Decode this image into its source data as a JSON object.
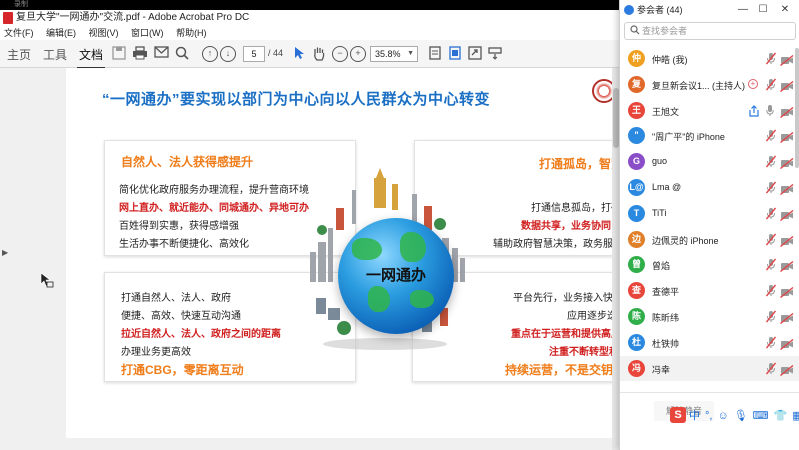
{
  "acrobat": {
    "top_strip": "录制",
    "window_title": "复旦大学\"一网通办\"交流.pdf - Adobe Acrobat Pro DC",
    "menu": [
      "文件(F)",
      "编辑(E)",
      "视图(V)",
      "窗口(W)",
      "帮助(H)"
    ],
    "tabs": [
      "主页",
      "工具",
      "文档"
    ],
    "active_tab": "文档",
    "page_current": "5",
    "page_total": "/ 44",
    "zoom": "35.8%"
  },
  "slide": {
    "title": "“一网通办”要实现以部门为中心向以人民群众为中心转变",
    "globe_label": "一网通办",
    "card_tl": {
      "heading": "自然人、法人获得感提升",
      "lines": [
        "简化优化政府服务办理流程，提升营商环境",
        "网上直办、就近能办、同城通办、异地可办",
        "百姓得到实惠，获得感增强",
        "生活办事不断便捷化、高效化"
      ]
    },
    "card_tr": {
      "heading": "打通孤岛，智慧",
      "lines": [
        "打通信息孤岛，打破",
        "数据共享，业务协同，",
        "辅助政府智慧决策，政务服务"
      ]
    },
    "card_bl": {
      "lines": [
        "打通自然人、法人、政府",
        "便捷、高效、快速互动沟通",
        "拉近自然人、法人、政府之间的距离",
        "办理业务更高效"
      ],
      "footer": "打通CBG，零距离互动"
    },
    "card_br": {
      "lines": [
        "平台先行，业务接入快速",
        "应用逐步迭",
        "重点在于运营和提供高质",
        "注重不断转型和"
      ],
      "footer": "持续运营，不是交钥"
    }
  },
  "participants": {
    "title": "参会者 (44)",
    "search_placeholder": "查找参会者",
    "list": [
      {
        "avatar": "仲",
        "name": "仲皓 (我)",
        "color": "#f0a020"
      },
      {
        "avatar": "复",
        "name": "复旦新会议1... (主持人)",
        "color": "#e0682a",
        "host": true
      },
      {
        "avatar": "王",
        "name": "王旭文",
        "color": "#e8463a",
        "sharing": true
      },
      {
        "avatar": "\"",
        "name": "\"周广平\"的 iPhone",
        "color": "#2b8ae0"
      },
      {
        "avatar": "G",
        "name": "guo",
        "color": "#8a4fc8"
      },
      {
        "avatar": "L@",
        "name": "Lma @",
        "color": "#2b8ae0"
      },
      {
        "avatar": "T",
        "name": "TiTi",
        "color": "#2b8ae0"
      },
      {
        "avatar": "边",
        "name": "边佩灵的 iPhone",
        "color": "#e0802a"
      },
      {
        "avatar": "曾",
        "name": "曾焰",
        "color": "#2fae4a"
      },
      {
        "avatar": "查",
        "name": "查德平",
        "color": "#e8463a"
      },
      {
        "avatar": "陈",
        "name": "陈昕纬",
        "color": "#2fae4a"
      },
      {
        "avatar": "杜",
        "name": "杜铁帅",
        "color": "#2b8ae0"
      },
      {
        "avatar": "冯",
        "name": "冯幸",
        "color": "#e8463a"
      }
    ],
    "mute_all": "解除静音",
    "ime_char": "中"
  }
}
